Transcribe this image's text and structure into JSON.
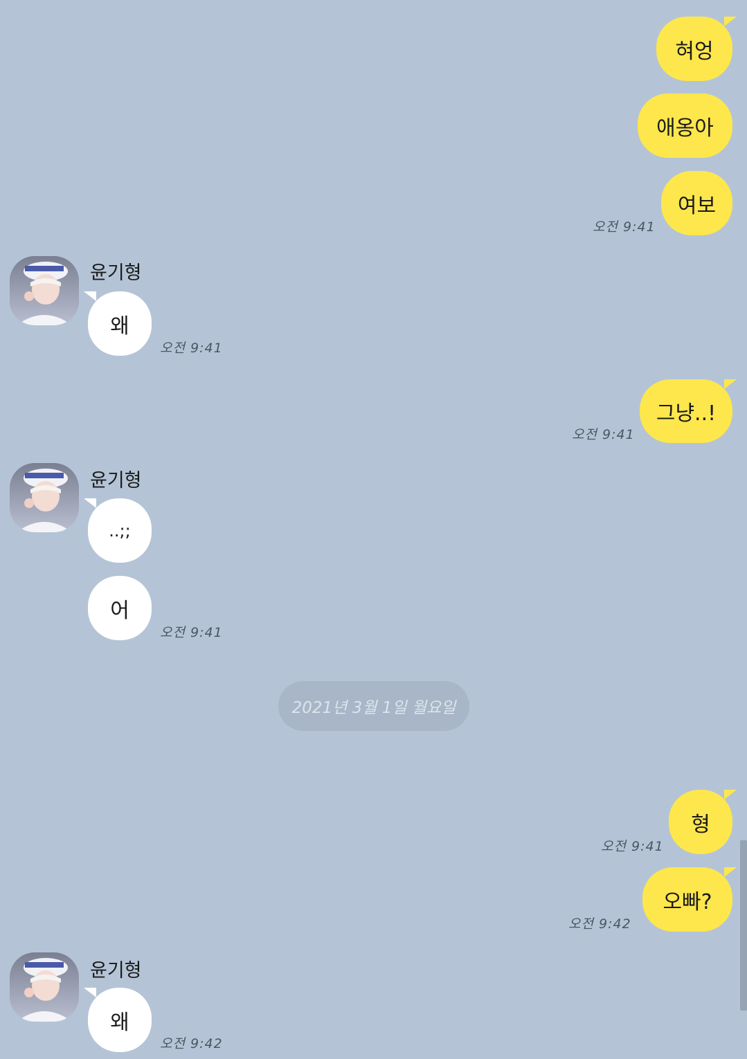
{
  "messages": {
    "m1": {
      "text": "혀엉"
    },
    "m2": {
      "text": "애옹아"
    },
    "m3": {
      "text": "여보",
      "time": "오전 9:41"
    },
    "m4": {
      "sender": "윤기형",
      "text": "왜",
      "time": "오전 9:41"
    },
    "m5": {
      "text": "그냥..!",
      "time": "오전 9:41"
    },
    "m6": {
      "sender": "윤기형",
      "text": "..;;"
    },
    "m7": {
      "text": "어",
      "time": "오전 9:41"
    },
    "m8": {
      "text": "형",
      "time": "오전 9:41"
    },
    "m9": {
      "text": "오빠?",
      "time": "오전 9:42"
    },
    "m10": {
      "sender": "윤기형",
      "text": "왜",
      "time": "오전 9:42"
    }
  },
  "date_divider": "2021년 3월 1일 월요일",
  "colors": {
    "background": "#b4c4d6",
    "my_bubble": "#fde74c",
    "their_bubble": "#ffffff",
    "date_pill": "#a8b6c7"
  },
  "icons": {
    "avatar": "profile-photo"
  }
}
